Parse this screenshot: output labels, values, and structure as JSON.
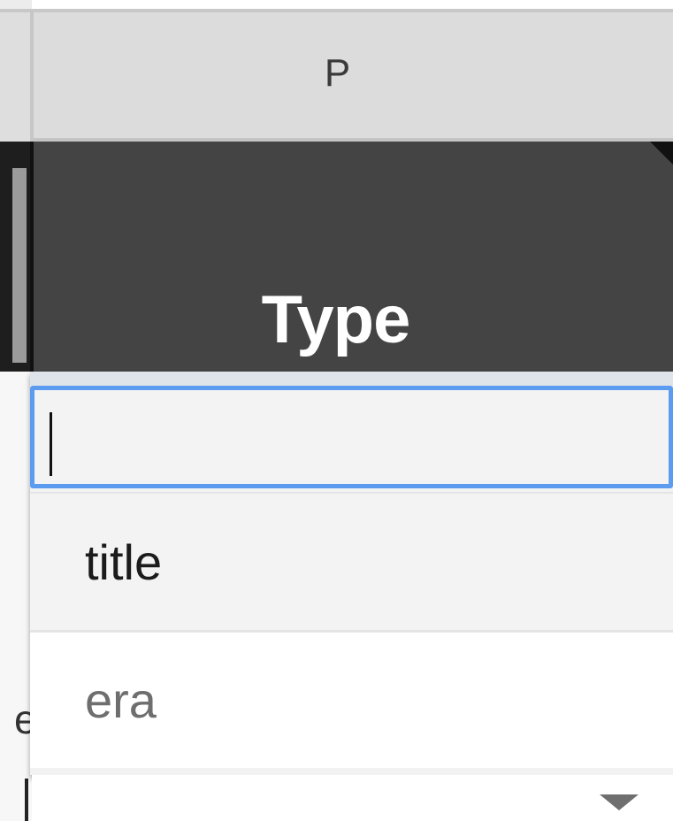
{
  "column_header": {
    "letter": "P"
  },
  "header_cell": {
    "label": "Type"
  },
  "dropdown": {
    "search_value": "",
    "options": [
      {
        "label": "title"
      },
      {
        "label": "era"
      }
    ]
  },
  "left_column": {
    "partial_text": "e"
  },
  "colors": {
    "accent_focus": "#5b9bf0",
    "header_dark": "#444444",
    "column_header_bg": "#dcdcdc"
  },
  "icons": [
    "dropdown-arrow-icon"
  ]
}
